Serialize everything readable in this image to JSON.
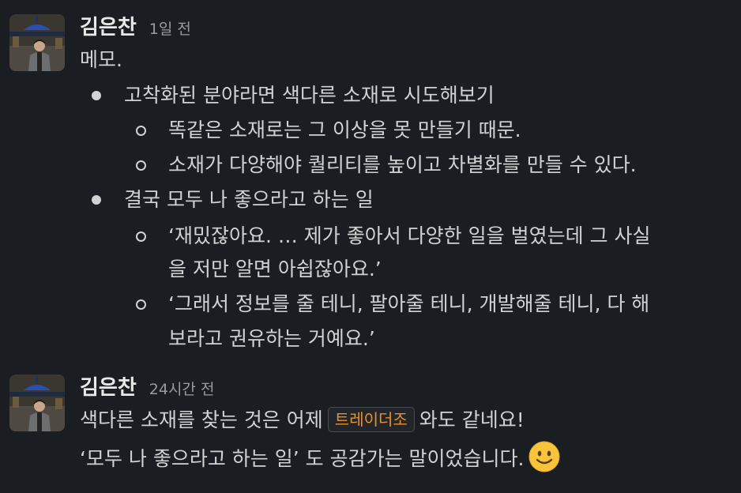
{
  "messages": [
    {
      "author": "김은찬",
      "time": "1일 전",
      "lines": {
        "title": "메모.",
        "l1_item": "고착화된 분야라면 색다른 소재로 시도해보기",
        "l1_sub1": "똑같은 소재로는 그 이상을 못 만들기 때문.",
        "l1_sub2": "소재가 다양해야 퀄리티를 높이고 차별화를 만들 수 있다.",
        "l2_item": "결국 모두 나 좋으라고 하는 일",
        "l2_sub1a": "‘재밌잖아요. … 제가 좋아서 다양한 일을 벌였는데 그 사실",
        "l2_sub1b": "을 저만 알면 아쉽잖아요.’",
        "l2_sub2a": "‘그래서 정보를 줄 테니, 팔아줄 테니, 개발해줄 테니, 다 해",
        "l2_sub2b": "보라고 권유하는 거예요.’"
      }
    },
    {
      "author": "김은찬",
      "time": "24시간 전",
      "line1_before": "색다른 소재를 찾는 것은 어제",
      "channel": "트레이더조",
      "line1_after": "와도 같네요!",
      "line2": "‘모두 나 좋으라고 하는 일’ 도 공감가는 말이었습니다.",
      "emoji": "slightly-smiling-face-icon"
    }
  ],
  "colors": {
    "background": "#1a1d21",
    "text": "#d1d2d3",
    "timestamp": "#9a9b9d",
    "channel_tag": "#e8912d"
  }
}
